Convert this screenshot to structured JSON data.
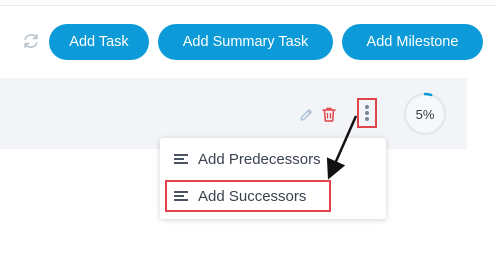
{
  "toolbar": {
    "refresh_icon": "refresh-icon",
    "add_task_label": "Add Task",
    "add_summary_task_label": "Add Summary Task",
    "add_milestone_label": "Add Milestone"
  },
  "task_row": {
    "edit_icon": "pencil-icon",
    "delete_icon": "trash-icon",
    "more_icon": "kebab-menu-icon",
    "progress_percent": 5,
    "progress_label": "5%"
  },
  "context_menu": {
    "items": [
      {
        "label": "Add Predecessors",
        "icon": "list-lines-icon"
      },
      {
        "label": "Add Successors",
        "icon": "list-lines-icon"
      }
    ]
  },
  "colors": {
    "accent": "#0d9ad8",
    "highlight": "#e0434a",
    "row_bg": "#f2f4f7",
    "progress": "#0d9ad8"
  }
}
